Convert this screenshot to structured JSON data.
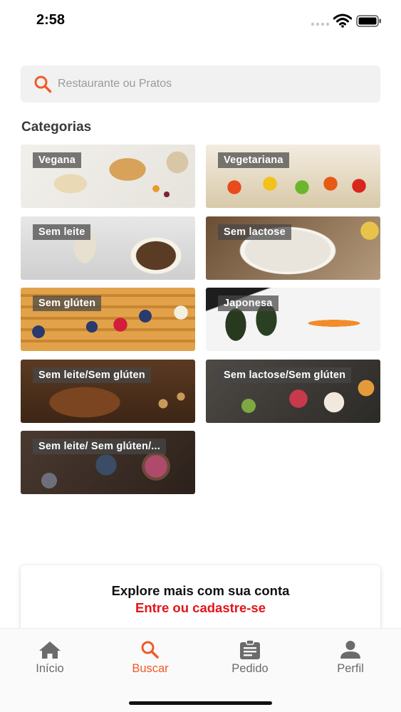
{
  "status_bar": {
    "time": "2:58"
  },
  "search": {
    "placeholder": "Restaurante ou Pratos"
  },
  "section_title": "Categorias",
  "categories": [
    {
      "label": "Vegana"
    },
    {
      "label": "Vegetariana"
    },
    {
      "label": "Sem leite"
    },
    {
      "label": "Sem lactose"
    },
    {
      "label": "Sem glúten"
    },
    {
      "label": "Japonesa"
    },
    {
      "label": "Sem leite/Sem glúten"
    },
    {
      "label": "Sem lactose/Sem glúten"
    },
    {
      "label": "Sem leite/ Sem glúten/..."
    }
  ],
  "login_banner": {
    "title": "Explore mais com sua conta",
    "link": "Entre ou cadastre-se"
  },
  "tabs": [
    {
      "label": "Início",
      "icon": "home-icon"
    },
    {
      "label": "Buscar",
      "icon": "search-icon"
    },
    {
      "label": "Pedido",
      "icon": "clipboard-icon"
    },
    {
      "label": "Perfil",
      "icon": "person-icon"
    }
  ],
  "colors": {
    "accent": "#f05a28",
    "link_red": "#e4141b",
    "tab_inactive": "#6b6b6b"
  }
}
